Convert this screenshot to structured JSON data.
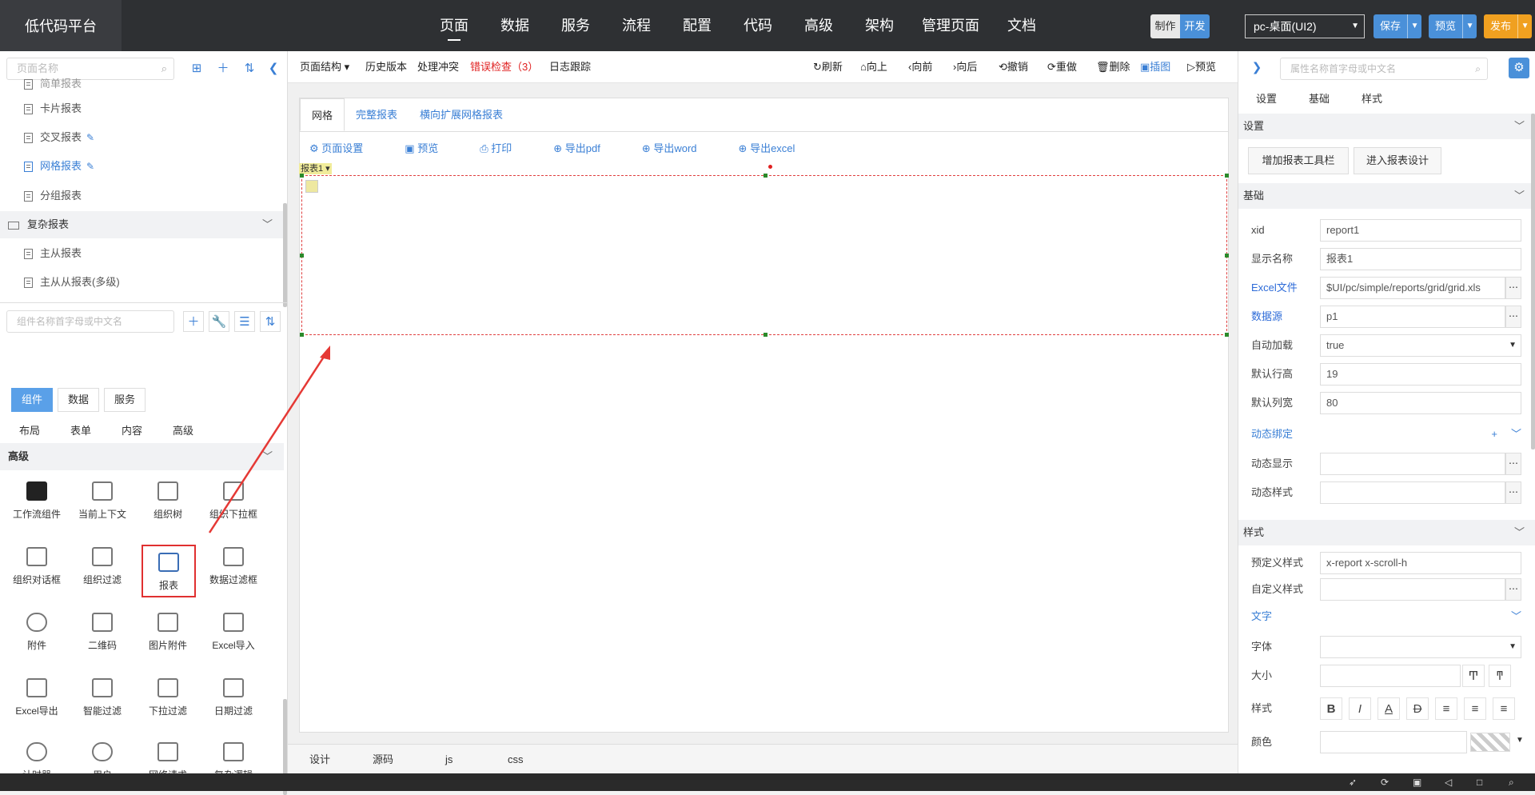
{
  "app": {
    "title": "低代码平台"
  },
  "nav": [
    "页面",
    "数据",
    "服务",
    "流程",
    "配置",
    "代码",
    "高级",
    "架构",
    "管理页面",
    "文档"
  ],
  "mode": {
    "make": "制作",
    "dev": "开发"
  },
  "device": {
    "value": "pc-桌面(UI2)"
  },
  "actions": {
    "save": "保存",
    "preview": "预览",
    "publish": "发布"
  },
  "left": {
    "page_search_placeholder": "页面名称",
    "tree_partial": "简单报表",
    "tree": [
      {
        "label": "卡片报表"
      },
      {
        "label": "交叉报表"
      },
      {
        "label": "网格报表"
      },
      {
        "label": "分组报表"
      }
    ],
    "group2": "复杂报表",
    "tree2": [
      {
        "label": "主从报表"
      },
      {
        "label": "主从从报表(多级)"
      }
    ],
    "comp_search_placeholder": "组件名称首字母或中文名",
    "tabs": [
      "组件",
      "数据",
      "服务"
    ],
    "subtabs": [
      "布局",
      "表单",
      "内容",
      "高级"
    ],
    "group": "高级",
    "components": [
      "工作流组件",
      "当前上下文",
      "组织树",
      "组织下拉框",
      "组织对话框",
      "组织过滤",
      "报表",
      "数据过滤框",
      "附件",
      "二维码",
      "图片附件",
      "Excel导入",
      "Excel导出",
      "智能过滤",
      "下拉过滤",
      "日期过滤",
      "计时器",
      "用户",
      "网络请求",
      "复杂逻辑"
    ]
  },
  "toolbar": {
    "structure": "页面结构",
    "history": "历史版本",
    "conflict": "处理冲突",
    "error": "错误检查（3）",
    "log": "日志跟踪",
    "right": [
      "刷新",
      "向上",
      "向前",
      "向后",
      "撤销",
      "重做",
      "删除",
      "插图",
      "预览"
    ]
  },
  "canvas": {
    "tabs": [
      "网格",
      "完整报表",
      "横向扩展网格报表"
    ],
    "tools": [
      "页面设置",
      "预览",
      "打印",
      "导出pdf",
      "导出word",
      "导出excel"
    ],
    "report_label": "报表1"
  },
  "bottom_tabs": [
    "设计",
    "源码",
    "js",
    "css"
  ],
  "right": {
    "search_placeholder": "属性名称首字母或中文名",
    "tabs": [
      "设置",
      "基础",
      "样式"
    ],
    "sec_settings": "设置",
    "btn_toolbar": "增加报表工具栏",
    "btn_design": "进入报表设计",
    "sec_basic": "基础",
    "props": [
      {
        "label": "xid",
        "value": "report1"
      },
      {
        "label": "显示名称",
        "value": "报表1"
      },
      {
        "label": "Excel文件",
        "value": "$UI/pc/simple/reports/grid/grid.xls"
      },
      {
        "label": "数据源",
        "value": "p1"
      },
      {
        "label": "自动加载",
        "value": "true"
      },
      {
        "label": "默认行高",
        "value": "19"
      },
      {
        "label": "默认列宽",
        "value": "80"
      }
    ],
    "dynamic": "动态绑定",
    "dyn_show": "动态显示",
    "dyn_style": "动态样式",
    "sec_style": "样式",
    "preset_style_label": "预定义样式",
    "preset_style_value": "x-report x-scroll-h",
    "custom_style_label": "自定义样式",
    "text_sec": "文字",
    "font_label": "字体",
    "size_label": "大小",
    "style_label": "样式",
    "color_label": "颜色"
  }
}
